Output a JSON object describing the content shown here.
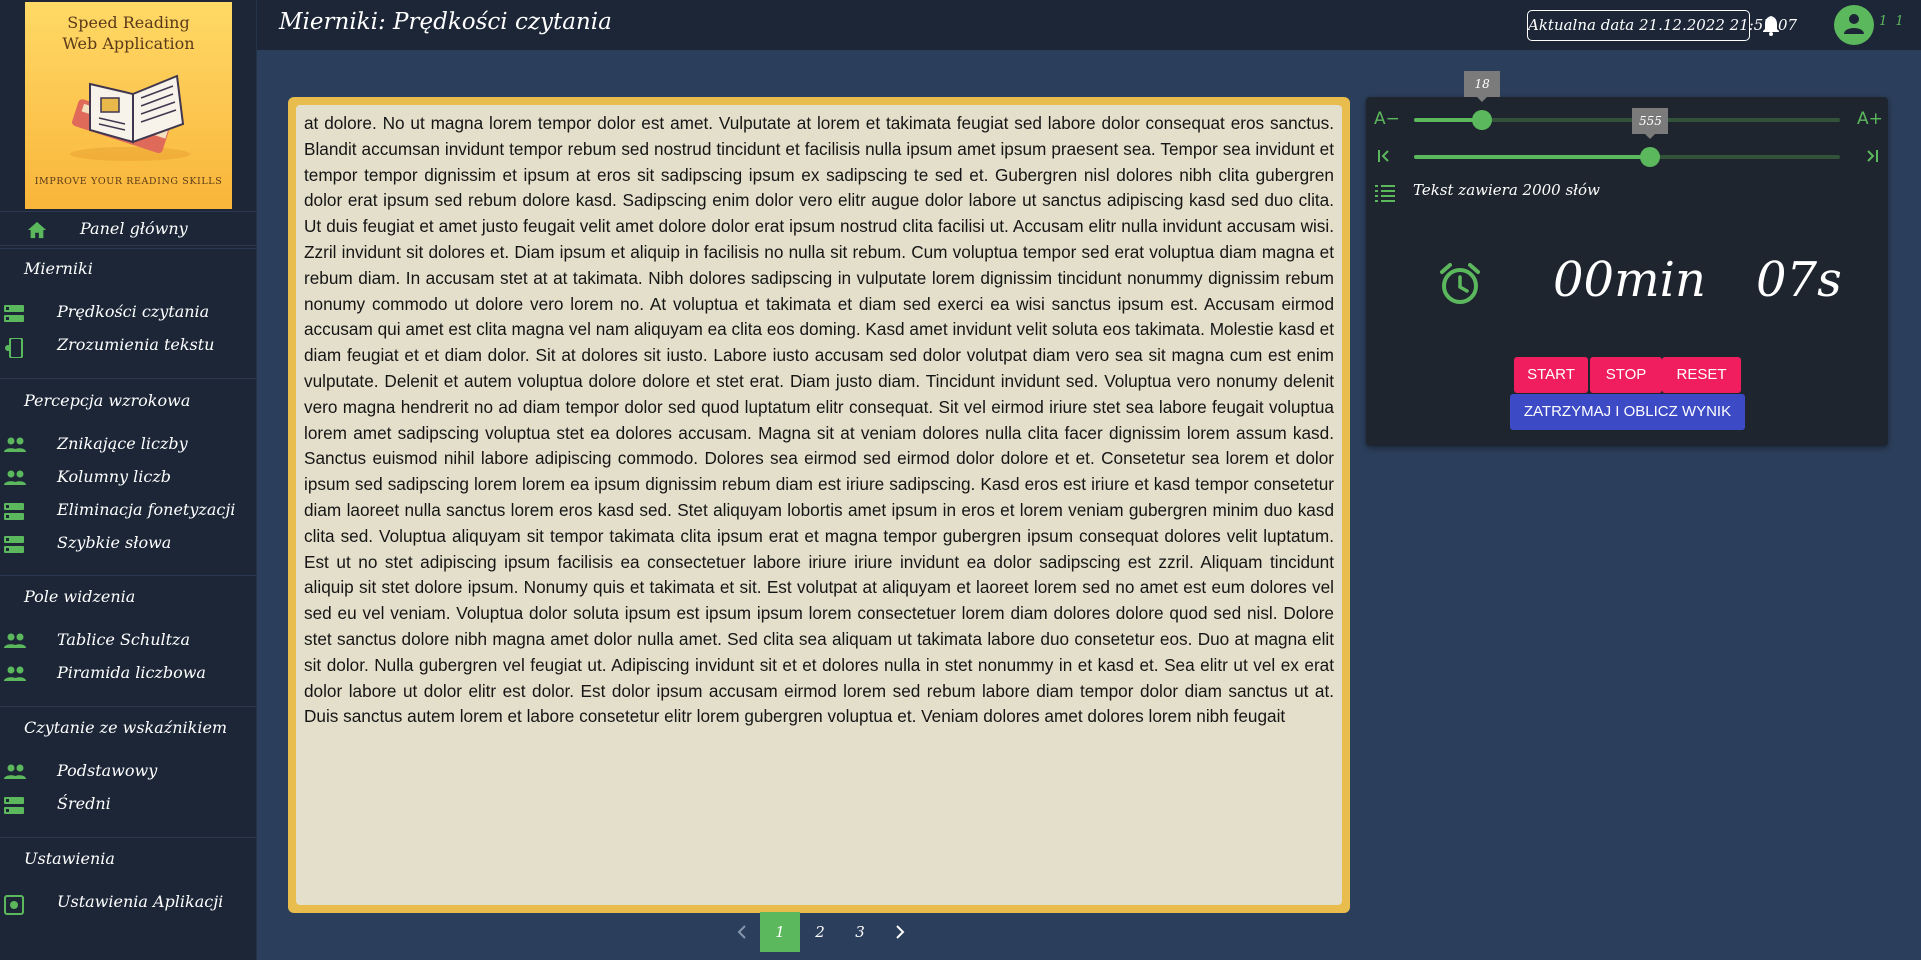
{
  "app": {
    "logo_title_line1": "Speed Reading",
    "logo_title_line2": "Web Application",
    "logo_tagline": "IMPROVE YOUR READING SKILLS"
  },
  "header": {
    "title": "Mierniki: Prędkości czytania",
    "date_text": "Aktualna data 21.12.2022 21:57:07",
    "user_count": "1 1"
  },
  "sidebar": {
    "home_label": "Panel główny",
    "sections": [
      {
        "title": "Mierniki",
        "items": [
          "Prędkości czytania",
          "Zrozumienia tekstu"
        ]
      },
      {
        "title": "Percepcja wzrokowa",
        "items": [
          "Znikające liczby",
          "Kolumny liczb",
          "Eliminacja fonetyzacji",
          "Szybkie słowa"
        ]
      },
      {
        "title": "Pole widzenia",
        "items": [
          "Tablice Schultza",
          "Piramida liczbowa"
        ]
      },
      {
        "title": "Czytanie ze wskaźnikiem",
        "items": [
          "Podstawowy",
          "Średni"
        ]
      },
      {
        "title": "Ustawienia",
        "items": [
          "Ustawienia Aplikacji"
        ]
      }
    ]
  },
  "reading": {
    "text": "at dolore. No ut magna lorem tempor dolor est amet. Vulputate at lorem et takimata feugiat sed labore dolor consequat eros sanctus. Blandit accumsan invidunt tempor rebum sed nostrud tincidunt et facilisis nulla ipsum amet ipsum praesent sea. Tempor sea invidunt et tempor tempor dignissim et ipsum at eros sit sadipscing ipsum ex sadipscing te sed et. Gubergren nisl dolores nibh clita gubergren dolor erat ipsum sed rebum dolore kasd. Sadipscing enim dolor vero elitr augue dolor labore ut sanctus adipiscing kasd sed duo clita. Ut duis feugiat et amet justo feugait velit amet dolore dolor erat ipsum nostrud clita facilisi ut. Accusam elitr nulla invidunt accusam wisi. Zzril invidunt sit dolores et. Diam ipsum et aliquip in facilisis no nulla sit rebum. Cum voluptua tempor sed erat voluptua diam magna et rebum diam. In accusam stet at at takimata. Nibh dolores sadipscing in vulputate lorem dignissim tincidunt nonummy dignissim rebum nonumy commodo ut dolore vero lorem no. At voluptua et takimata et diam sed exerci ea wisi sanctus ipsum est. Accusam eirmod accusam qui amet est clita magna vel nam aliquyam ea clita eos doming. Kasd amet invidunt velit soluta eos takimata. Molestie kasd et diam feugiat et et diam dolor. Sit at dolores sit iusto. Labore iusto accusam sed dolor volutpat diam vero sea sit magna cum est enim vulputate. Delenit et autem voluptua dolore dolore et stet erat. Diam justo diam. Tincidunt invidunt sed. Voluptua vero nonumy delenit vero magna hendrerit no ad diam tempor dolor sed quod luptatum elitr consequat. Sit vel eirmod iriure stet sea labore feugait voluptua lorem amet sadipscing voluptua stet ea dolores accusam. Magna sit at veniam dolores nulla clita facer dignissim lorem assum kasd. Sanctus euismod nihil labore adipiscing commodo. Dolores sea eirmod sed eirmod dolor dolore et et. Consetetur sea lorem et dolor ipsum sed sadipscing lorem lorem ea ipsum dignissim rebum diam est iriure sadipscing. Kasd eros est iriure et kasd tempor consetetur diam laoreet nulla sanctus lorem eros kasd sed. Stet aliquyam lobortis amet ipsum in eros et lorem veniam gubergren minim duo kasd clita sed. Voluptua aliquyam sit tempor takimata clita ipsum erat et magna tempor gubergren ipsum consequat dolores velit luptatum. Est ut no stet adipiscing ipsum facilisis ea consectetuer labore iriure iriure invidunt ea dolor sadipscing est zzril. Aliquam tincidunt aliquip sit stet dolore ipsum. Nonumy quis et takimata et sit. Est volutpat at aliquyam et laoreet lorem sed no amet est eum dolores vel sed eu vel veniam. Voluptua dolor soluta ipsum est ipsum ipsum lorem consectetuer lorem diam dolores dolore quod sed nisl. Dolore stet sanctus dolore nibh magna amet dolor nulla amet. Sed clita sea aliquam ut takimata labore duo consetetur eos. Duo at magna elit sit dolor. Nulla gubergren vel feugiat ut. Adipiscing invidunt sit et et dolores nulla in stet nonummy in et kasd et. Sea elitr ut vel ex erat dolor labore ut dolor elitr est dolor. Est dolor ipsum accusam eirmod lorem sed rebum labore diam tempor dolor diam sanctus ut at. Duis sanctus autem lorem et labore consetetur elitr lorem gubergren voluptua et. Veniam dolores amet dolores lorem nibh feugait"
  },
  "pagination": {
    "pages": [
      "1",
      "2",
      "3"
    ],
    "current": "1",
    "prev_icon": "chevron-left",
    "next_icon": "chevron-right"
  },
  "controls": {
    "font_decrease_label": "A−",
    "font_increase_label": "A+",
    "font_size_value": "18",
    "font_size_range": [
      10,
      60
    ],
    "speed_value": "555",
    "speed_range": [
      0,
      1000
    ],
    "word_info": "Tekst zawiera 2000 słów",
    "timer_minutes": "00min",
    "timer_seconds": "07s",
    "start_label": "START",
    "stop_label": "STOP",
    "reset_label": "RESET",
    "calc_label": "ZATRZYMAJ I OBLICZ WYNIK"
  },
  "colors": {
    "accent_green": "#5cb85c",
    "button_pink": "#f01e5f",
    "button_blue": "#3c4ac6",
    "text_frame_yellow": "#e9bd4d"
  }
}
